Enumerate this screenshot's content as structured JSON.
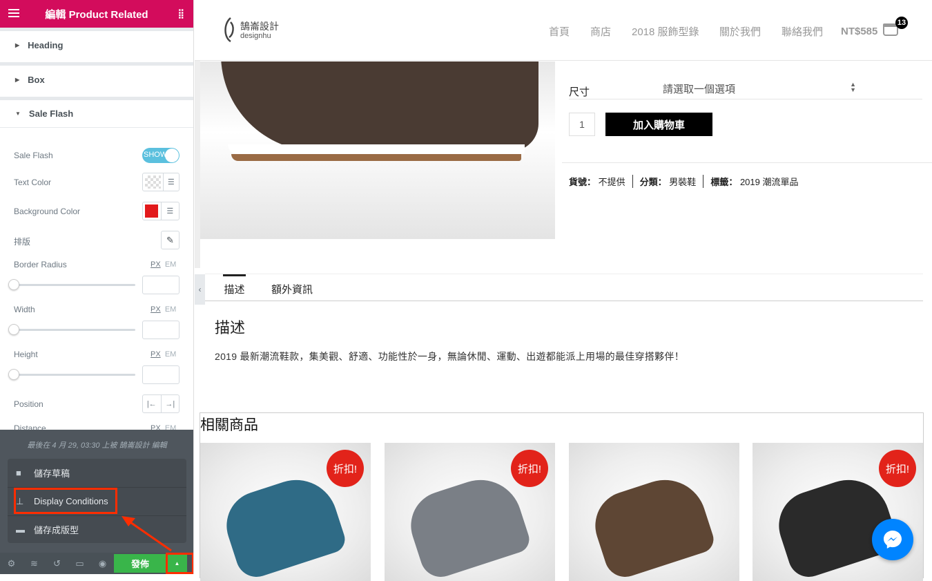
{
  "panel": {
    "title": "編輯 Product Related",
    "sections": [
      {
        "label": "Heading",
        "open": false
      },
      {
        "label": "Box",
        "open": false
      },
      {
        "label": "Sale Flash",
        "open": true
      }
    ],
    "controls": {
      "sale_flash": {
        "label": "Sale Flash",
        "toggle": "SHOW",
        "on": true
      },
      "text_color": {
        "label": "Text Color"
      },
      "bg_color": {
        "label": "Background Color",
        "value": "#e2191b"
      },
      "typography": {
        "label": "排版"
      },
      "border_radius": {
        "label": "Border Radius",
        "unit_px": "PX",
        "unit_em": "EM",
        "value": 0
      },
      "width": {
        "label": "Width",
        "unit_px": "PX",
        "unit_em": "EM",
        "value": 0
      },
      "height": {
        "label": "Height",
        "unit_px": "PX",
        "unit_em": "EM",
        "value": 0
      },
      "position": {
        "label": "Position"
      },
      "distance": {
        "label": "Distance",
        "unit_px": "PX",
        "unit_em": "EM"
      }
    },
    "last_edited": "最後在 4 月 29, 03:30 上被 鵠崙設計 編輯",
    "menu": [
      {
        "label": "儲存草稿",
        "icon": "save-icon"
      },
      {
        "label": "Display Conditions",
        "icon": "sitemap-icon"
      },
      {
        "label": "儲存成版型",
        "icon": "folder-icon"
      }
    ],
    "publish": "發佈",
    "accent": "#d30c5c",
    "publish_color": "#39b54a",
    "highlight_color": "#ff2d00"
  },
  "site": {
    "logo": {
      "text": "鵠崙設計",
      "sub": "designhu"
    },
    "nav": [
      "首頁",
      "商店",
      "2018 服飾型錄",
      "關於我們",
      "聯絡我們"
    ],
    "cart_total": "NT$585",
    "cart_count": "13"
  },
  "product": {
    "size_label": "尺寸",
    "size_placeholder": "請選取一個選項",
    "qty": "1",
    "add_to_cart": "加入購物車",
    "meta": [
      {
        "k": "貨號：",
        "v": "不提供"
      },
      {
        "k": "分類：",
        "v": "男裝鞋"
      },
      {
        "k": "標籤：",
        "v": "2019 潮流單品"
      }
    ],
    "tabs": [
      "描述",
      "額外資訊"
    ],
    "desc_title": "描述",
    "desc": "2019 最新潮流鞋款，集美觀、舒適、功能性於一身，無論休閒、運動、出遊都能派上用場的最佳穿搭夥伴！"
  },
  "related": {
    "title": "相關商品",
    "items": [
      {
        "sale": "折扣!",
        "color": "#2f6b86"
      },
      {
        "sale": "折扣!",
        "color": "#7a7f86"
      },
      {
        "sale": "",
        "color": "#5e4634"
      },
      {
        "sale": "折扣!",
        "color": "#2a2a2a"
      }
    ]
  }
}
